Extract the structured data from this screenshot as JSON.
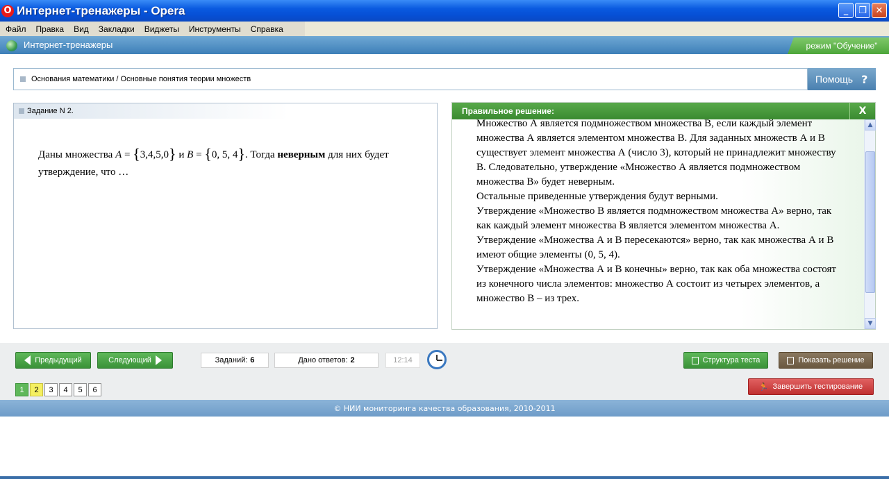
{
  "window": {
    "title": "Интернет-тренажеры - Opera",
    "logo": "O",
    "minimize": "_",
    "maximize": "❐",
    "close": "✕"
  },
  "menu": [
    "Файл",
    "Правка",
    "Вид",
    "Закладки",
    "Виджеты",
    "Инструменты",
    "Справка"
  ],
  "app": {
    "name": "Интернет-тренажеры",
    "mode": "режим \"Обучение\""
  },
  "breadcrumb": "Основания математики / Основные понятия теории множеств",
  "help": {
    "label": "Помощь",
    "icon": "?"
  },
  "task": {
    "header": "Задание N 2.",
    "intro": "Даны множества ",
    "set_a_name": "A",
    "set_a_open": "{",
    "set_a_values": "3,4,5,0",
    "set_a_close": "}",
    "conj": " и ",
    "set_b_name": "B",
    "set_b_open": "{",
    "set_b_values": "0, 5, 4",
    "set_b_close": "}",
    "mid": ". Тогда ",
    "bold_word": "неверным",
    "tail": " для них будет утверждение, что …"
  },
  "solution": {
    "header": "Правильное решение:",
    "close": "X",
    "paragraphs": [
      "Множество А является подмножеством множества В, если каждый элемент множества А является элементом множества В. Для заданных множеств А и В существует элемент множества А (число 3), который не принадлежит множеству В. Следовательно, утверждение «Множество А является подмножеством множества В» будет неверным.",
      "Остальные приведенные утверждения будут верными.",
      "Утверждение «Множество В является подмножеством множества А» верно, так как каждый элемент множества В является элементом множества А.",
      "Утверждение «Множества А и В пересекаются» верно, так как множества А и В имеют общие элементы (0, 5, 4).",
      "Утверждение «Множества А и В конечны» верно, так как оба множества состоят из конечного числа элементов: множество А состоит из четырех элементов, а множество В – из трех."
    ]
  },
  "toolbar": {
    "prev": "Предыдущий",
    "next": "Следующий",
    "tasks_label": "Заданий:",
    "tasks_count": "6",
    "answers_label": "Дано ответов:",
    "answers_count": "2",
    "timer": "12:14",
    "structure": "Структура теста",
    "show_solution": "Показать решение",
    "finish": "Завершить тестирование"
  },
  "pages": [
    "1",
    "2",
    "3",
    "4",
    "5",
    "6"
  ],
  "footer": "© НИИ мониторинга качества образования, 2010-2011"
}
